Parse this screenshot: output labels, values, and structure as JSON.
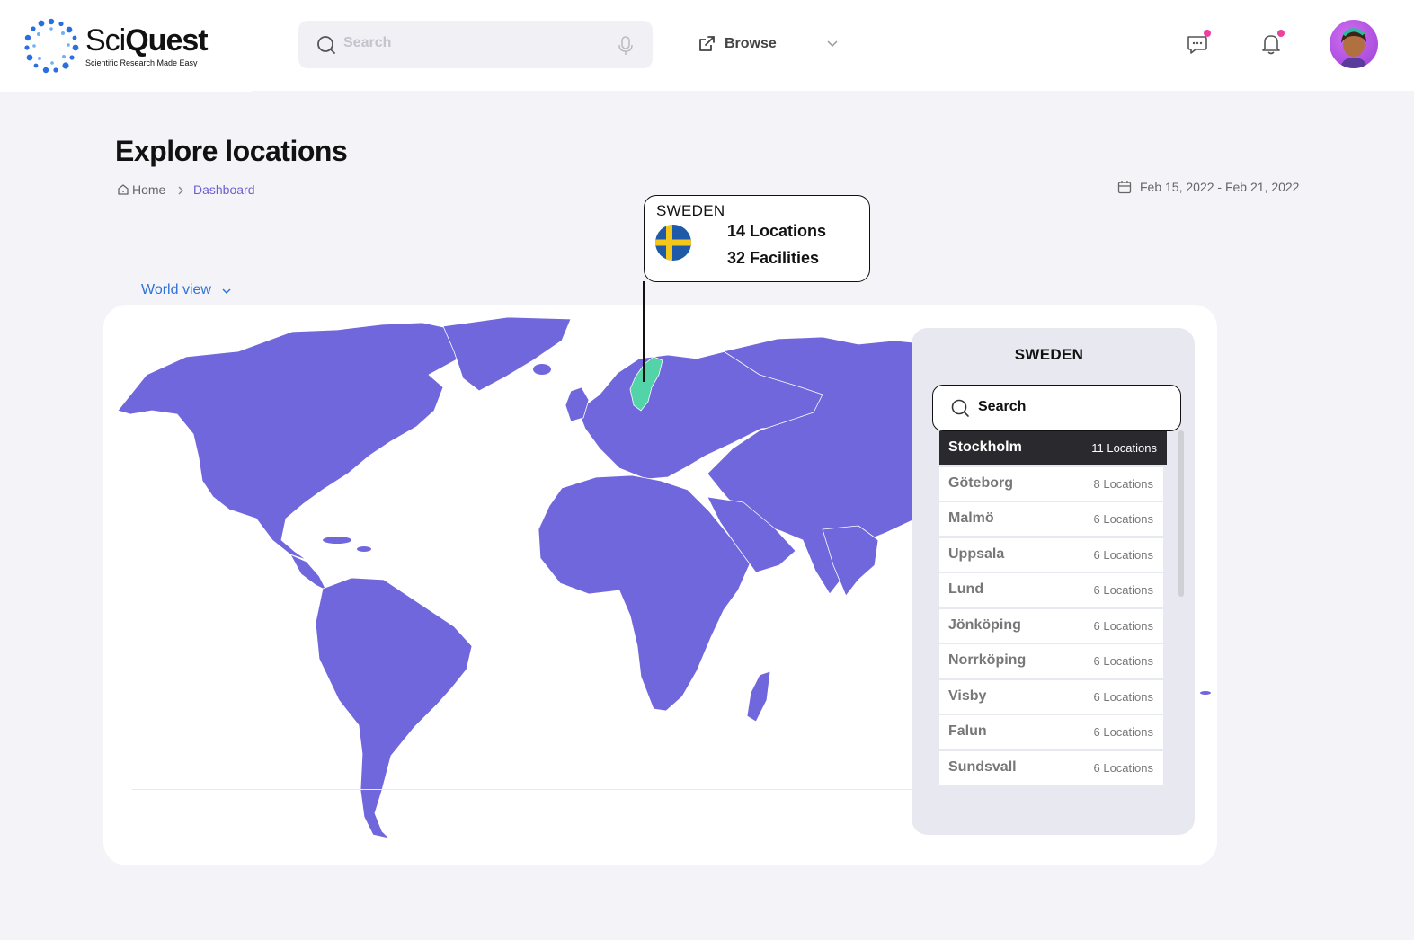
{
  "brand": {
    "name_part1": "Sci",
    "name_part2": "Quest",
    "tagline": "Scientific Research Made Easy"
  },
  "header": {
    "search_placeholder": "Search",
    "browse_label": "Browse",
    "icons": [
      "search-icon",
      "microphone-icon",
      "external-link-icon",
      "chevron-down-icon",
      "chat-icon",
      "bell-icon",
      "avatar"
    ],
    "accent_dot_color": "#ee3fa0"
  },
  "page": {
    "title": "Explore locations",
    "breadcrumb": {
      "home": "Home",
      "current": "Dashboard"
    },
    "date_range": "Feb 15, 2022 - Feb 21, 2022"
  },
  "map": {
    "view_selector": "World view",
    "land_color": "#7167dc",
    "highlight_color": "#52d3a8",
    "highlighted_country": "Sweden"
  },
  "tooltip": {
    "country": "SWEDEN",
    "locations": "14 Locations",
    "facilities": "32 Facilities"
  },
  "panel": {
    "title": "SWEDEN",
    "search_label": "Search",
    "cities": [
      {
        "name": "Stockholm",
        "count": "11 Locations",
        "active": true
      },
      {
        "name": "Göteborg",
        "count": "8 Locations",
        "active": false
      },
      {
        "name": "Malmö",
        "count": "6 Locations",
        "active": false
      },
      {
        "name": "Uppsala",
        "count": "6 Locations",
        "active": false
      },
      {
        "name": "Lund",
        "count": "6 Locations",
        "active": false
      },
      {
        "name": "Jönköping",
        "count": "6 Locations",
        "active": false
      },
      {
        "name": "Norrköping",
        "count": "6 Locations",
        "active": false
      },
      {
        "name": "Visby",
        "count": "6 Locations",
        "active": false
      },
      {
        "name": "Falun",
        "count": "6 Locations",
        "active": false
      },
      {
        "name": "Sundsvall",
        "count": "6 Locations",
        "active": false
      }
    ]
  }
}
